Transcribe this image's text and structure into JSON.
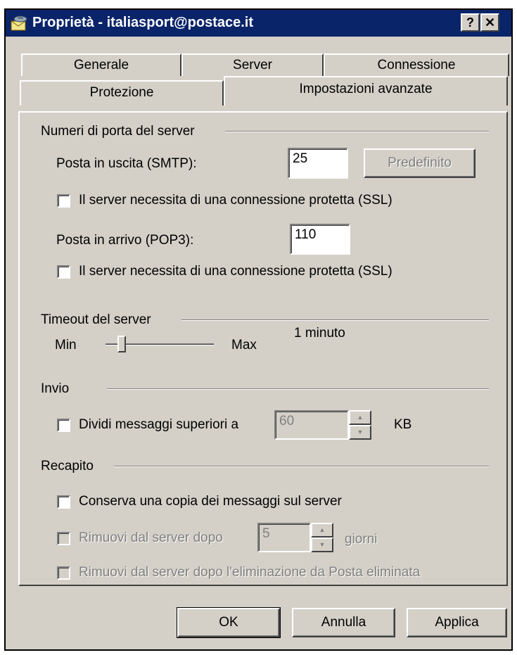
{
  "window": {
    "title": "Proprietà - italiasport@postace.it",
    "help_label": "?",
    "close_label": "✕"
  },
  "tabs": {
    "generale": "Generale",
    "server": "Server",
    "connessione": "Connessione",
    "protezione": "Protezione",
    "avanzate": "Impostazioni avanzate"
  },
  "ports": {
    "group_label": "Numeri di porta del server",
    "smtp_label": "Posta in uscita (SMTP):",
    "smtp_value": "25",
    "default_button": "Predefinito",
    "smtp_ssl_label": "Il server necessita di una connessione protetta (SSL)",
    "pop3_label": "Posta in arrivo (POP3):",
    "pop3_value": "110",
    "pop3_ssl_label": "Il server necessita di una connessione protetta (SSL)"
  },
  "timeout": {
    "group_label": "Timeout del server",
    "min_label": "Min",
    "max_label": "Max",
    "value_text": "1 minuto",
    "slider_fraction": 0.12
  },
  "invio": {
    "group_label": "Invio",
    "split_label": "Dividi messaggi superiori a",
    "split_value": "60",
    "unit": "KB"
  },
  "recapito": {
    "group_label": "Recapito",
    "keep_copy_label": "Conserva una copia dei messaggi sul server",
    "remove_after_label": "Rimuovi dal server dopo",
    "remove_after_value": "5",
    "remove_unit": "giorni",
    "remove_deleted_label": "Rimuovi dal server dopo l'eliminazione da Posta eliminata"
  },
  "buttons": {
    "ok": "OK",
    "cancel": "Annulla",
    "apply": "Applica"
  },
  "colors": {
    "titlebar": "#0a246a",
    "face": "#d4d0c8",
    "disabled_text": "#808080"
  }
}
